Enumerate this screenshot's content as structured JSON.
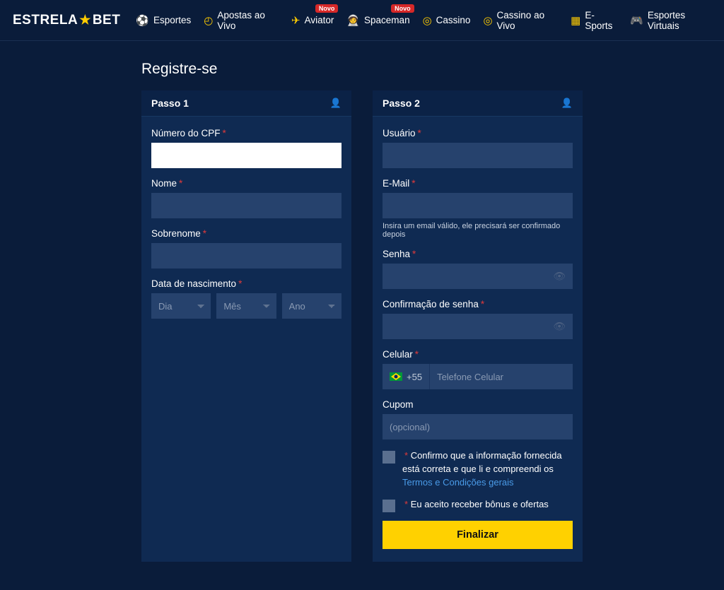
{
  "brand": {
    "part1": "ESTRELA",
    "part2": "BET"
  },
  "nav": [
    {
      "label": "Esportes",
      "badge": null
    },
    {
      "label": "Apostas ao Vivo",
      "badge": null
    },
    {
      "label": "Aviator",
      "badge": "Novo"
    },
    {
      "label": "Spaceman",
      "badge": "Novo"
    },
    {
      "label": "Cassino",
      "badge": null
    },
    {
      "label": "Cassino ao Vivo",
      "badge": null
    },
    {
      "label": "E-Sports",
      "badge": null
    },
    {
      "label": "Esportes Virtuais",
      "badge": null
    }
  ],
  "page": {
    "title": "Registre-se"
  },
  "step1": {
    "title": "Passo 1",
    "cpf_label": "Número do CPF",
    "nome_label": "Nome",
    "sobrenome_label": "Sobrenome",
    "dob_label": "Data de nascimento",
    "dob_day": "Dia",
    "dob_month": "Mês",
    "dob_year": "Ano"
  },
  "step2": {
    "title": "Passo 2",
    "usuario_label": "Usuário",
    "email_label": "E-Mail",
    "email_hint": "Insira um email válido, ele precisará ser confirmado depois",
    "senha_label": "Senha",
    "confirma_label": "Confirmação de senha",
    "celular_label": "Celular",
    "phone_prefix": "+55",
    "phone_placeholder": "Telefone Celular",
    "cupom_label": "Cupom",
    "cupom_placeholder": "(opcional)",
    "consent_prefix": "Confirmo que a informação fornecida está correta e que li e compreendi os ",
    "consent_link": "Termos e Condições gerais",
    "bonus_label": "Eu aceito receber bônus e ofertas",
    "submit": "Finalizar"
  }
}
